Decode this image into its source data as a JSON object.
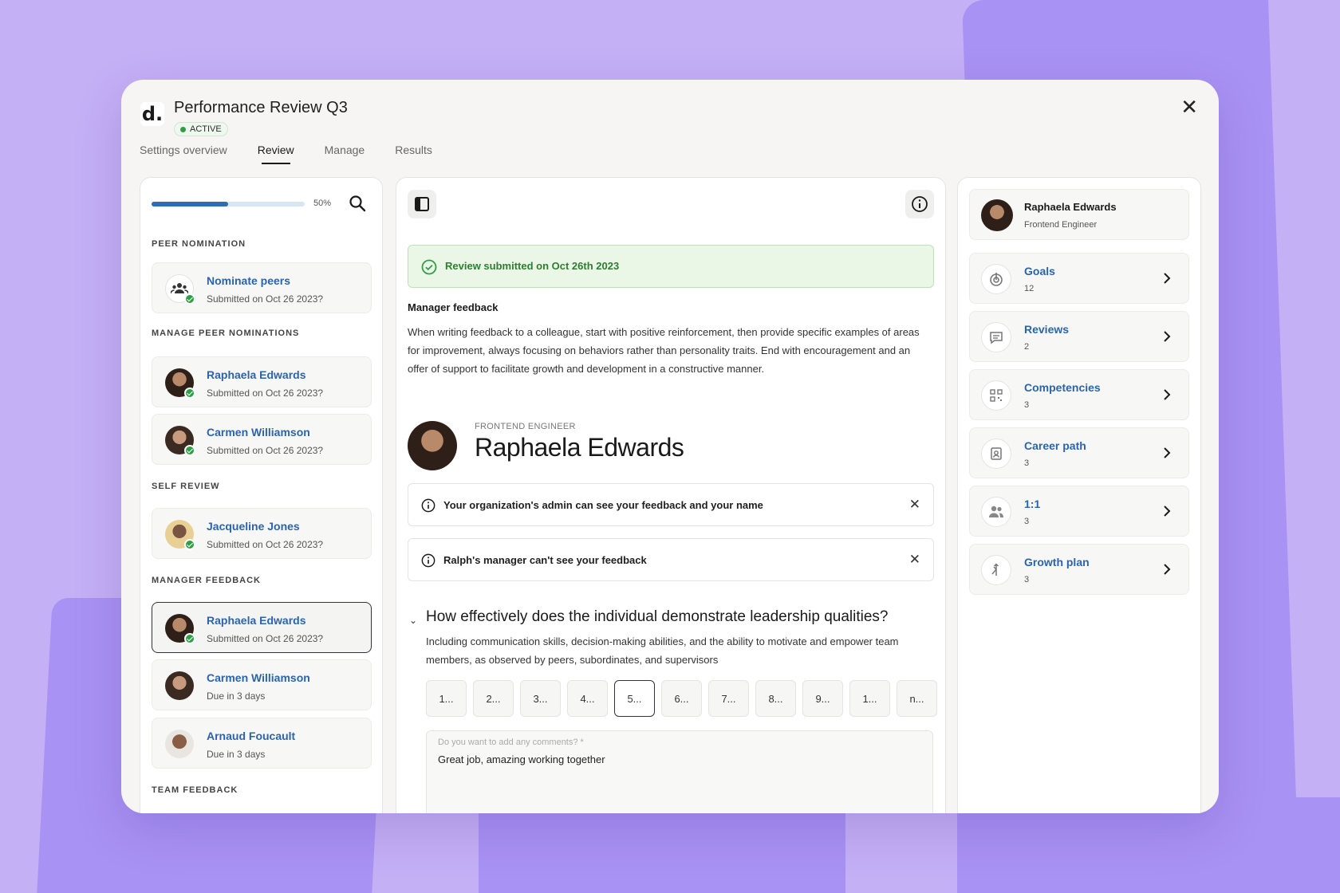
{
  "app": {
    "title": "Performance Review Q3",
    "status": "ACTIVE",
    "logo": "d."
  },
  "tabs": [
    "Settings overview",
    "Review",
    "Manage",
    "Results"
  ],
  "active_tab": "Review",
  "progress": {
    "value": 0.5,
    "label": "50%"
  },
  "left": {
    "sections": {
      "peer_nomination": "PEER NOMINATION",
      "manage_peer": "MANAGE PEER NOMINATIONS",
      "self_review": "SELF REVIEW",
      "manager_feedback": "MANAGER FEEDBACK",
      "team_feedback": "TEAM FEEDBACK"
    },
    "items": [
      {
        "name": "Nominate peers",
        "status": "Submitted on Oct 26 2023?",
        "check": true
      },
      {
        "name": "Raphaela Edwards",
        "status": "Submitted on Oct 26 2023?",
        "check": true
      },
      {
        "name": "Carmen Williamson",
        "status": "Submitted on Oct 26 2023?",
        "check": true
      },
      {
        "name": "Jacqueline Jones",
        "status": "Submitted on Oct 26 2023?",
        "check": true
      },
      {
        "name": "Raphaela Edwards",
        "status": "Submitted on Oct 26 2023?",
        "check": true,
        "selected": true
      },
      {
        "name": "Carmen Williamson",
        "status": "Due in 3 days",
        "check": false
      },
      {
        "name": "Arnaud Foucault",
        "status": "Due in 3 days",
        "check": false
      }
    ]
  },
  "main": {
    "submitted": "Review submitted on Oct 26th 2023",
    "manager_heading": "Manager feedback",
    "manager_text": "When writing feedback to a colleague, start with positive reinforcement, then provide specific examples of areas for improvement, always focusing on behaviors rather than personality traits. End with encouragement and an offer of support to facilitate growth and development in a constructive manner.",
    "person_role": "FRONTEND ENGINEER",
    "person_name": "Raphaela Edwards",
    "notes": [
      "Your organization's admin can see your feedback and your name",
      "Ralph's manager can't see your feedback"
    ],
    "question": "How effectively does the individual demonstrate leadership qualities?",
    "question_desc": "Including communication skills, decision-making abilities, and the ability to motivate and empower team members, as observed by peers, subordinates, and supervisors",
    "options": [
      "1...",
      "2...",
      "3...",
      "4...",
      "5...",
      "6...",
      "7...",
      "8...",
      "9...",
      "1...",
      "n..."
    ],
    "selected_option": 4,
    "comment_placeholder": "Do you want to add any comments? *",
    "comment_value": "Great job, amazing working together"
  },
  "right": {
    "profile": {
      "name": "Raphaela Edwards",
      "role": "Frontend Engineer"
    },
    "links": [
      {
        "label": "Goals",
        "count": "12",
        "icon": "target-icon"
      },
      {
        "label": "Reviews",
        "count": "2",
        "icon": "message-icon"
      },
      {
        "label": "Competencies",
        "count": "3",
        "icon": "qr-grid-icon"
      },
      {
        "label": "Career path",
        "count": "3",
        "icon": "badge-icon"
      },
      {
        "label": "1:1",
        "count": "3",
        "icon": "people-icon"
      },
      {
        "label": "Growth plan",
        "count": "3",
        "icon": "merge-icon"
      }
    ]
  },
  "colors": {
    "accent": "#2b64ad",
    "success": "#2f9e44",
    "background": "#c4b0f5"
  }
}
